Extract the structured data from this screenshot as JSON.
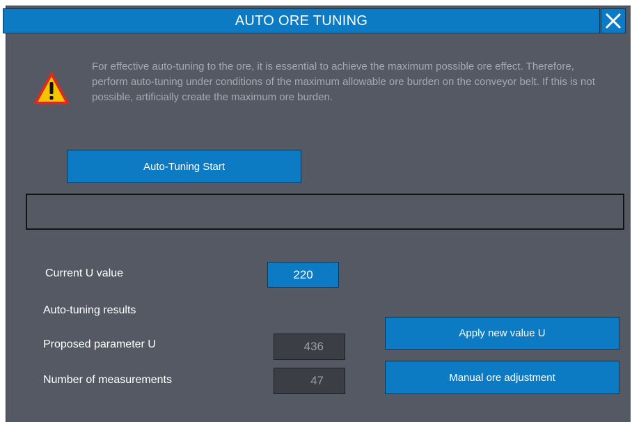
{
  "dialog": {
    "title": "AUTO ORE TUNING",
    "close_icon": "close-icon"
  },
  "warning": {
    "icon": "warning-icon",
    "text": "For effective auto-tuning to the ore, it is essential to achieve the maximum possible ore effect. Therefore, perform auto-tuning under conditions of the maximum allowable ore burden on the conveyor belt. If this is not possible, artificially create the maximum ore burden."
  },
  "buttons": {
    "start_label": "Auto-Tuning Start",
    "apply_label": "Apply new value U",
    "manual_label": "Manual ore adjustment"
  },
  "status": {
    "text": ""
  },
  "fields": {
    "current_u_label": "Current U value",
    "current_u_value": "220",
    "results_label": "Auto-tuning results",
    "proposed_label": "Proposed parameter U",
    "proposed_value": "436",
    "measurements_label": "Number of measurements",
    "measurements_value": "47"
  },
  "colors": {
    "accent": "#0d7ac4",
    "panel": "#545964",
    "warning_fill": "#f5c400",
    "warning_border": "#d92b20"
  }
}
